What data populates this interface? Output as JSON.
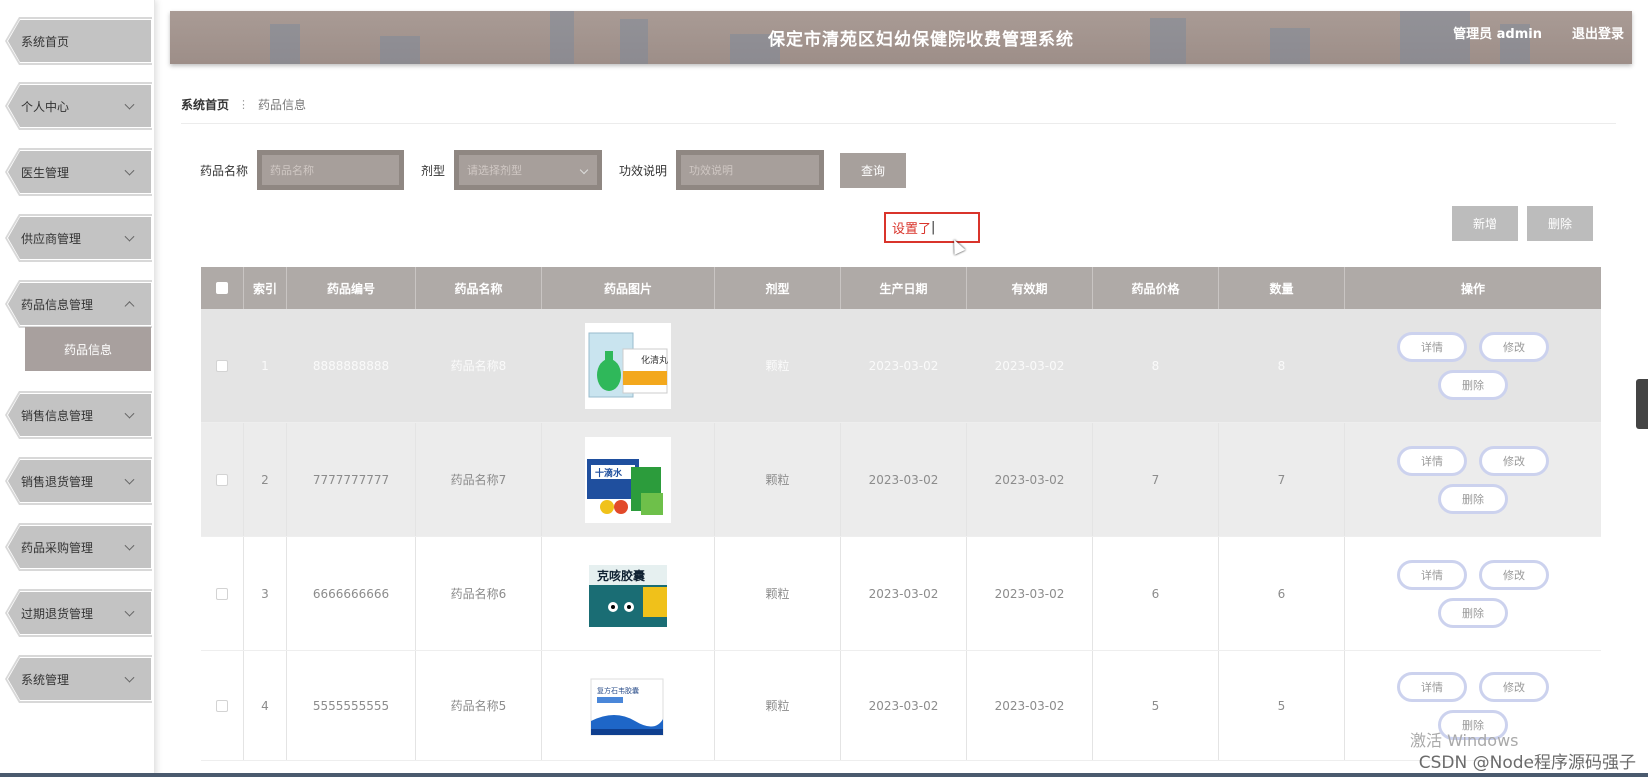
{
  "header": {
    "title": "保定市清苑区妇幼保健院收费管理系统",
    "user": "管理员 admin",
    "logout": "退出登录"
  },
  "sidebar": {
    "items": [
      {
        "label": "系统首页"
      },
      {
        "label": "个人中心"
      },
      {
        "label": "医生管理"
      },
      {
        "label": "供应商管理"
      },
      {
        "label": "药品信息管理"
      },
      {
        "label": "销售信息管理"
      },
      {
        "label": "销售退货管理"
      },
      {
        "label": "药品采购管理"
      },
      {
        "label": "过期退货管理"
      },
      {
        "label": "系统管理"
      }
    ],
    "submenu_active": "药品信息"
  },
  "breadcrumb": {
    "home": "系统首页",
    "current": "药品信息"
  },
  "search": {
    "name_label": "药品名称",
    "name_placeholder": "药品名称",
    "type_label": "剂型",
    "type_placeholder": "请选择剂型",
    "desc_label": "功效说明",
    "desc_placeholder": "功效说明",
    "query_button": "查询"
  },
  "actions": {
    "add_button": "新增",
    "delete_button": "删除"
  },
  "annotation": "设置了",
  "table": {
    "columns": [
      "索引",
      "药品编号",
      "药品名称",
      "药品图片",
      "剂型",
      "生产日期",
      "有效期",
      "药品价格",
      "数量",
      "操作"
    ],
    "rows": [
      {
        "index": "1",
        "code": "8888888888",
        "name": "药品名称8",
        "type": "颗粒",
        "mfg": "2023-03-02",
        "exp": "2023-03-02",
        "price": "8",
        "qty": "8",
        "pic_text": "化清丸"
      },
      {
        "index": "2",
        "code": "7777777777",
        "name": "药品名称7",
        "type": "颗粒",
        "mfg": "2023-03-02",
        "exp": "2023-03-02",
        "price": "7",
        "qty": "7",
        "pic_text": "十滴水"
      },
      {
        "index": "3",
        "code": "6666666666",
        "name": "药品名称6",
        "type": "颗粒",
        "mfg": "2023-03-02",
        "exp": "2023-03-02",
        "price": "6",
        "qty": "6",
        "pic_text": "克咳胶囊"
      },
      {
        "index": "4",
        "code": "5555555555",
        "name": "药品名称5",
        "type": "颗粒",
        "mfg": "2023-03-02",
        "exp": "2023-03-02",
        "price": "5",
        "qty": "5",
        "pic_text": "复方石韦胶囊"
      }
    ],
    "op_detail": "详情",
    "op_edit": "修改",
    "op_delete": "删除"
  },
  "watermark": "激活 Windows",
  "csdn": "CSDN @Node程序源码强子"
}
